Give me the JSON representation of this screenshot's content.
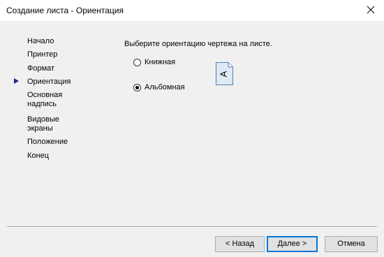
{
  "window": {
    "title": "Создание листа - Ориентация"
  },
  "steps": [
    {
      "label": "Начало"
    },
    {
      "label": "Принтер"
    },
    {
      "label": "Формат"
    },
    {
      "label": "Ориентация",
      "current": true
    },
    {
      "label": "Основная\nнадпись"
    },
    {
      "label": "Видовые\nэкраны"
    },
    {
      "label": "Положение"
    },
    {
      "label": "Конец"
    }
  ],
  "main": {
    "prompt": "Выберите ориентацию чертежа на листе.",
    "options": [
      {
        "label": "Книжная",
        "selected": false
      },
      {
        "label": "Альбомная",
        "selected": true
      }
    ],
    "preview_letter": "A"
  },
  "buttons": {
    "back": "< Назад",
    "next": "Далее >",
    "cancel": "Отмена"
  },
  "colors": {
    "accent": "#0078d7",
    "step_marker": "#1a2b88"
  }
}
